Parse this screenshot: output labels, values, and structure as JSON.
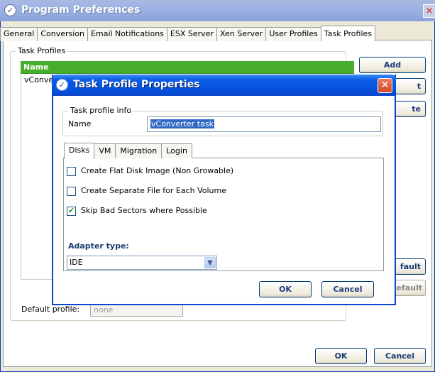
{
  "main_window": {
    "title": "Program Preferences",
    "close_glyph": "×",
    "tabs": [
      "General",
      "Conversion",
      "Email Notifications",
      "ESX Server",
      "Xen Server",
      "User Profiles",
      "Task Profiles"
    ],
    "active_tab": "Task Profiles",
    "group_label": "Task Profiles",
    "list_header": "Name",
    "list_rows": [
      "vConve"
    ],
    "buttons": {
      "add": "Add",
      "edit": "t",
      "delete": "te",
      "set_default": "fault",
      "clear_default": "efault",
      "ok": "OK",
      "cancel": "Cancel"
    },
    "default_profile_label": "Default profile:",
    "default_profile_value": "none"
  },
  "dialog": {
    "title": "Task Profile Properties",
    "close_glyph": "✕",
    "info_group_label": "Task profile info",
    "name_label": "Name",
    "name_value": "vConverter task",
    "tabs": [
      "Disks",
      "VM",
      "Migration",
      "Login"
    ],
    "active_tab": "Disks",
    "options": [
      {
        "label": "Create Flat Disk Image (Non Growable)",
        "checked": false
      },
      {
        "label": "Create Separate File for Each Volume",
        "checked": false
      },
      {
        "label": "Skip Bad Sectors where Possible",
        "checked": true
      }
    ],
    "adapter_label": "Adapter type:",
    "adapter_value": "IDE",
    "ok": "OK",
    "cancel": "Cancel"
  },
  "icons": {
    "app": "app-logo-icon",
    "close": "close-icon",
    "dropdown": "chevron-down-icon",
    "check": "check-icon"
  },
  "colors": {
    "list_header": "#47ad2c",
    "dialog_title": "#0a5ce6",
    "selection": "#316ac5"
  }
}
